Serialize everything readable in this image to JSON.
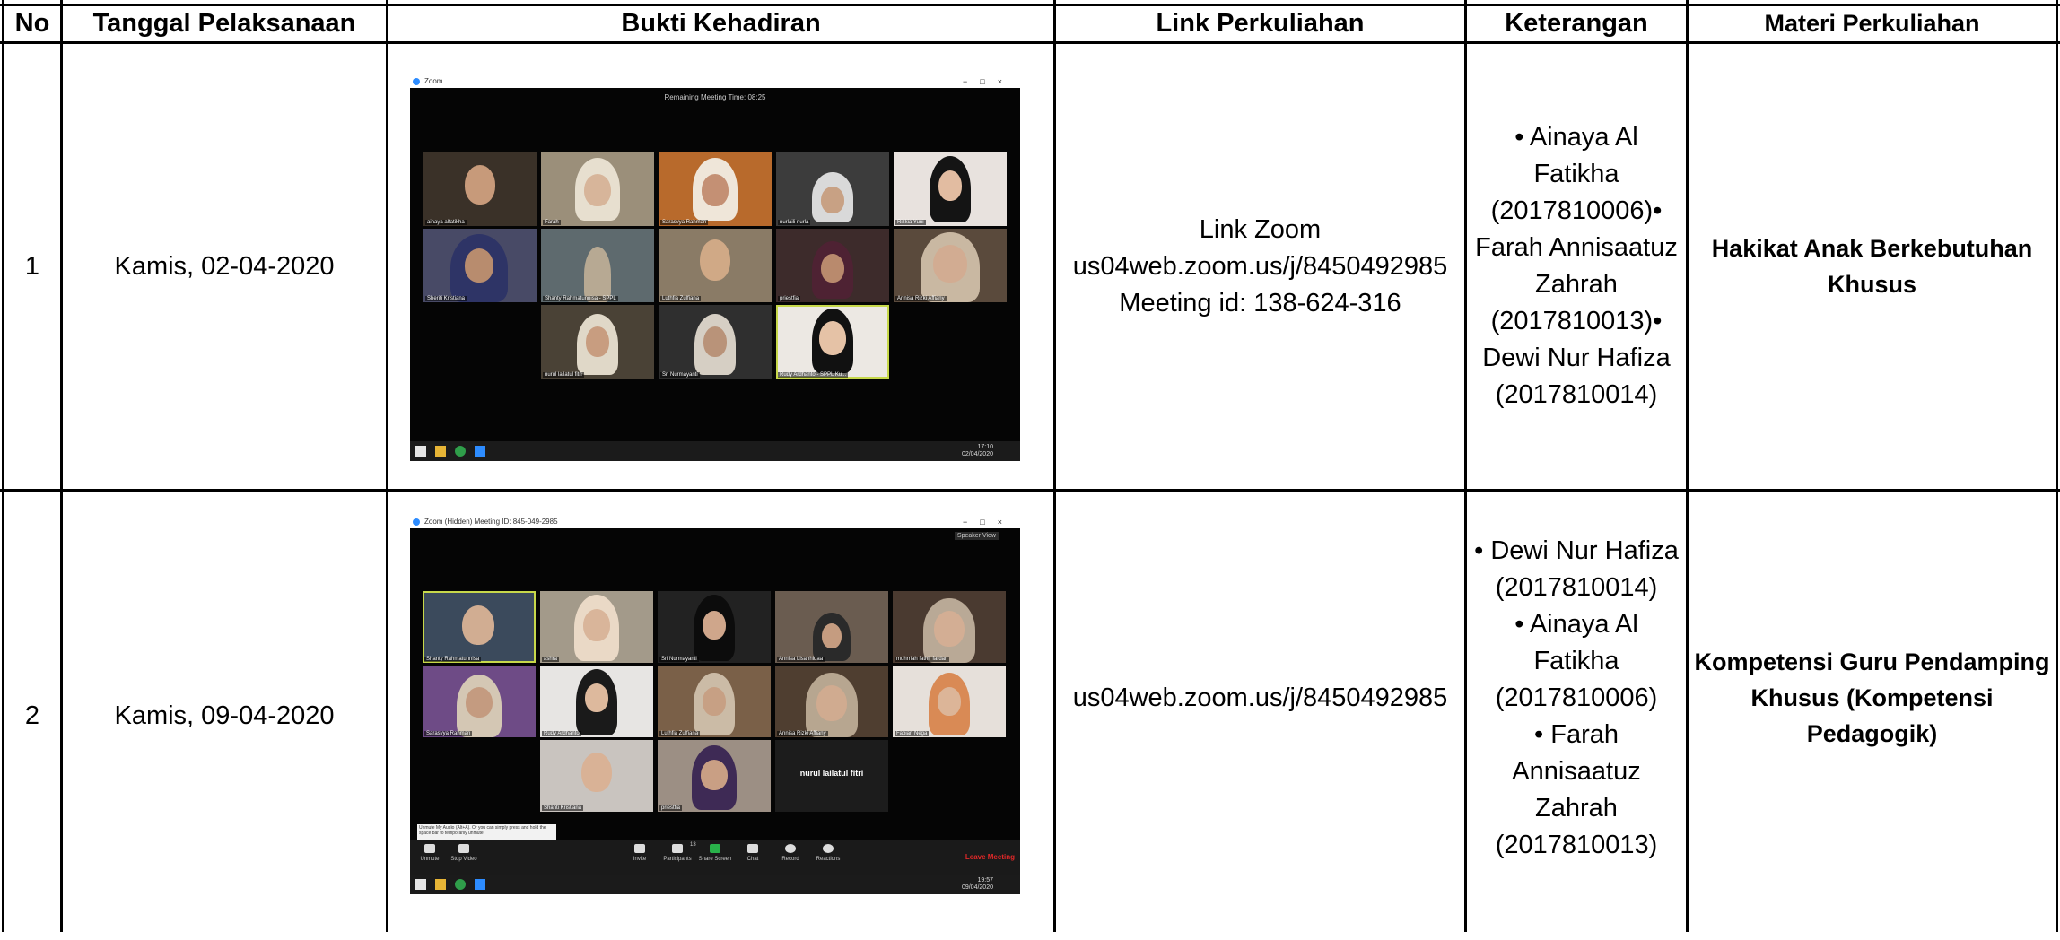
{
  "table": {
    "headers": {
      "no": "No",
      "tanggal": "Tanggal Pelaksanaan",
      "bukti": "Bukti Kehadiran",
      "link": "Link Perkuliahan",
      "keterangan": "Keterangan",
      "materi": "Materi Perkuliahan"
    },
    "rows": [
      {
        "no": "1",
        "tanggal": "Kamis, 02-04-2020",
        "link_lines": [
          "Link Zoom",
          "us04web.zoom.us/j/8450492985",
          "Meeting id: 138-624-316"
        ],
        "keterangan_lines": [
          "• Ainaya Al",
          "Fatikha",
          "(2017810006)•",
          "Farah Annisaatuz",
          "Zahrah",
          "(2017810013)•",
          "Dewi Nur Hafiza",
          "(2017810014)"
        ],
        "materi_lines": [
          "Hakikat Anak Berkebutuhan",
          "Khusus"
        ],
        "screenshot": {
          "app": "Zoom",
          "top_info": "Remaining Meeting Time: 08:25",
          "clock_time": "17:10",
          "clock_date": "02/04/2020",
          "participants": [
            "ainaya alfatikha",
            "Farah",
            "Sarasvya Rahman",
            "nurlaili nurla",
            "Rizkia Yuni",
            "Sheriti Kristiana",
            "Shanty Rahmatunnisa - SPPL",
            "Luthfia Zulfiana",
            "priestfia",
            "Annisa Rizki Affiany",
            "nurul lailatul fitri",
            "Sri Nurmayanti",
            "Rudy Ardhanto - SPPL Ku..."
          ]
        }
      },
      {
        "no": "2",
        "tanggal": "Kamis, 09-04-2020",
        "link_lines": [
          "us04web.zoom.us/j/8450492985"
        ],
        "keterangan_lines": [
          "• Dewi Nur Hafiza",
          "(2017810014)",
          "• Ainaya Al",
          "Fatikha",
          "(2017810006)",
          "• Farah",
          "Annisaatuz",
          "Zahrah",
          "(2017810013)"
        ],
        "materi_lines": [
          "Kompetensi Guru Pendamping",
          "Khusus (Kompetensi Pedagogik)"
        ],
        "screenshot": {
          "app": "Zoom",
          "title": "Zoom (Hidden) Meeting ID: 845-049-2985",
          "speaker_view": "Speaker View",
          "clock_time": "19:57",
          "clock_date": "09/04/2020",
          "end_meeting": "Leave Meeting",
          "hint": "Unmute My Audio (Alt+A). Or you can simply press and hold the space bar to temporarily unmute.",
          "tools": [
            "Unmute",
            "Stop Video",
            "Invite",
            "Participants",
            "Share Screen",
            "Chat",
            "Record",
            "Reactions"
          ],
          "participant_count": "13",
          "participants": [
            "Shanty Rahmatunnisa",
            "ashra",
            "Sri Nurmayanti",
            "Annisa Lisanhidaa",
            "muhrriah fathir fardan",
            "Sarasvya Rahman",
            "Rudy Ardhanto",
            "Luthfia Zulfiana",
            "Annisa Rizki Affiany",
            "Fabian Nega",
            "Shanti Kristiana",
            "priestfia",
            "nurul lailatul fitri"
          ]
        }
      }
    ]
  },
  "colors": {
    "border": "#000000",
    "zoom_bg": "#050505",
    "active_speaker": "#c7d84a",
    "end_meeting": "#e02828"
  }
}
